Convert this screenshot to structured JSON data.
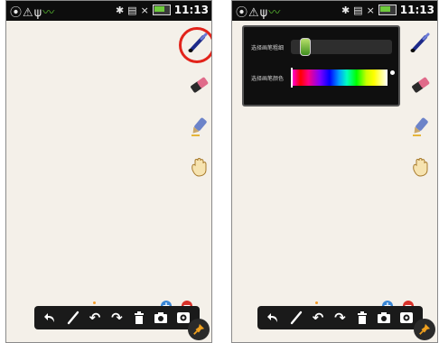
{
  "statusbar": {
    "left_icons": [
      "alarm-icon",
      "warning-icon",
      "usb-icon",
      "leaf-icon"
    ],
    "right_icons": [
      "bluetooth-icon",
      "signal-icon",
      "battery-icon"
    ],
    "time": "11:13",
    "no_signal_mark": "×"
  },
  "tools": [
    "brush-icon",
    "eraser-icon",
    "marker-icon",
    "hand-icon"
  ],
  "popup": {
    "brush_size_label": "选择画笔粗细",
    "brush_color_label": "选择画笔颜色",
    "brush_size_value": 0.1,
    "brush_color_value": 0.0
  },
  "zoom": {
    "plus": "+",
    "minus": "−"
  },
  "bottom_toolbar": {
    "items": [
      "back-icon",
      "brush-icon",
      "undo-icon",
      "redo-icon",
      "trash-icon",
      "camera-icon",
      "save-icon"
    ],
    "undo_glyph": "↶",
    "redo_glyph": "↷"
  },
  "colors": {
    "highlight": "#e2231a",
    "canvas": "#f4f0e9",
    "accent": "#55b42f"
  }
}
